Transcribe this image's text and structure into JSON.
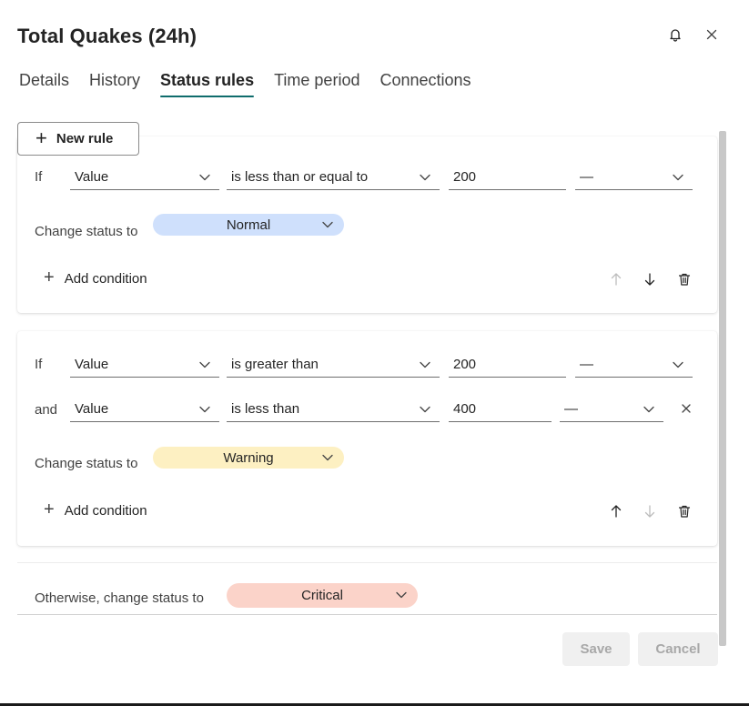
{
  "header": {
    "title": "Total Quakes (24h)",
    "bell_icon": "bell-icon",
    "close_icon": "close-icon"
  },
  "tabs": [
    {
      "label": "Details",
      "active": false
    },
    {
      "label": "History",
      "active": false
    },
    {
      "label": "Status rules",
      "active": true
    },
    {
      "label": "Time period",
      "active": false
    },
    {
      "label": "Connections",
      "active": false
    }
  ],
  "toolbar": {
    "new_rule_label": "New rule"
  },
  "rules": [
    {
      "conditions": [
        {
          "connector": "If",
          "field": "Value",
          "operator": "is less than or equal to",
          "value": "200",
          "unit": "—"
        }
      ],
      "change_status_label": "Change status to",
      "status": "Normal",
      "status_color": "#cfe0fc",
      "add_condition_label": "Add condition"
    },
    {
      "conditions": [
        {
          "connector": "If",
          "field": "Value",
          "operator": "is greater than",
          "value": "200",
          "unit": "—"
        },
        {
          "connector": "and",
          "field": "Value",
          "operator": "is less than",
          "value": "400",
          "unit": "—"
        }
      ],
      "change_status_label": "Change status to",
      "status": "Warning",
      "status_color": "#fdf0c2",
      "add_condition_label": "Add condition"
    }
  ],
  "otherwise": {
    "label": "Otherwise, change status to",
    "status": "Critical",
    "status_color": "#fbd3c9"
  },
  "footer": {
    "save_label": "Save",
    "cancel_label": "Cancel"
  }
}
